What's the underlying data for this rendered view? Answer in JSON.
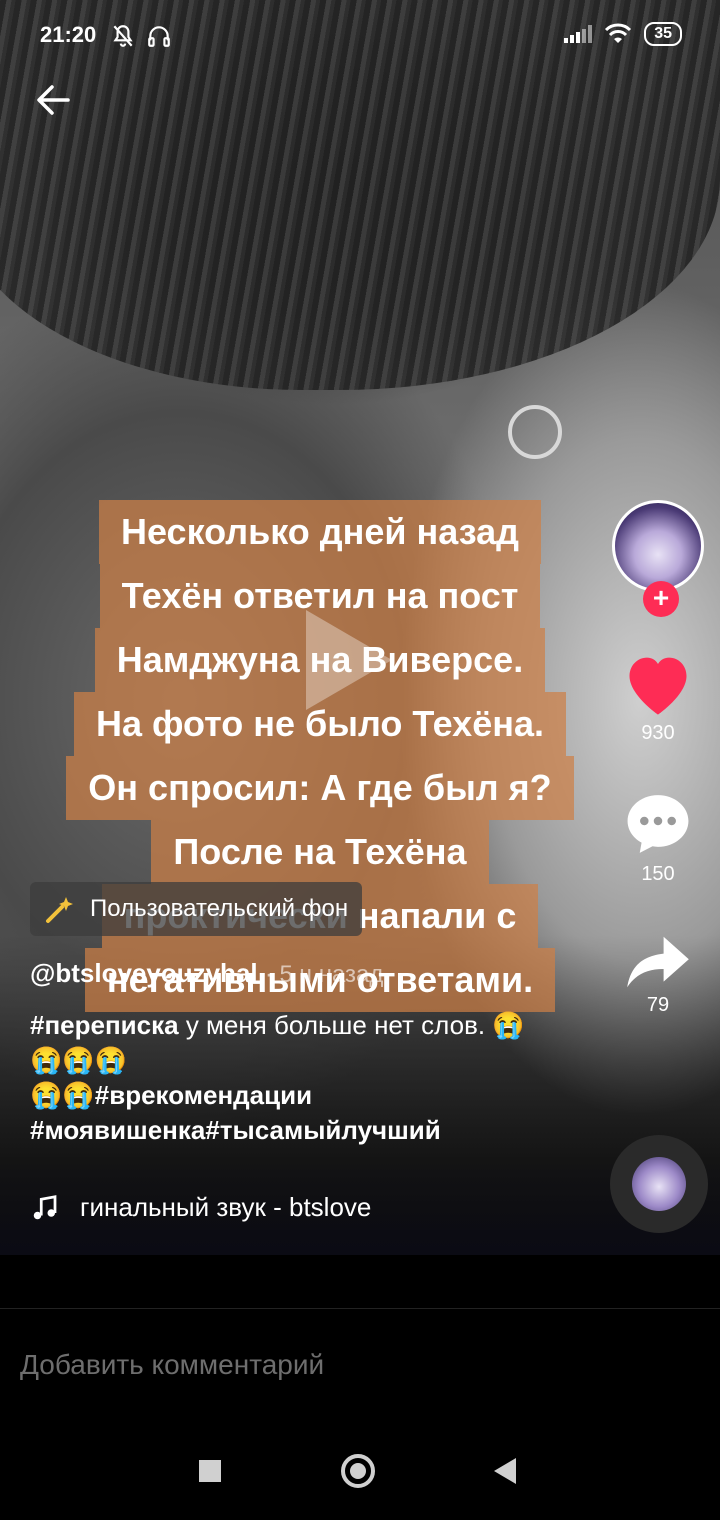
{
  "status_bar": {
    "time": "21:20",
    "battery": "35"
  },
  "video": {
    "overlay_lines": [
      "Несколько дней назад",
      "Техён ответил на пост",
      "Намджуна на Виверсе.",
      "На фото не было Техёна.",
      "Он спросил: А где был я?",
      "После на Техёна",
      "проктически напали с",
      "негативными ответами."
    ]
  },
  "rail": {
    "likes": "930",
    "comments": "150",
    "shares": "79",
    "follow_symbol": "+"
  },
  "background_tag": {
    "icon": "sparkle-wand-icon",
    "label": "Пользовательский фон"
  },
  "post": {
    "username": "@btsloveyouzyhal",
    "time_ago": "· 5 ч назад",
    "caption_hashtag_1": "#переписка",
    "caption_text_1": " у меня больше нет слов. 😭😭😭😭",
    "caption_line_2": "😭😭",
    "caption_hashtag_2": "#врекомендации",
    "caption_hashtag_3": "#моявишенка#тысамыйлучший",
    "sound": "гинальный звук - btslove"
  },
  "comment_bar": {
    "placeholder": "Добавить комментарий"
  },
  "colors": {
    "like": "#fe2c55",
    "overlay_box": "#cd8046"
  }
}
